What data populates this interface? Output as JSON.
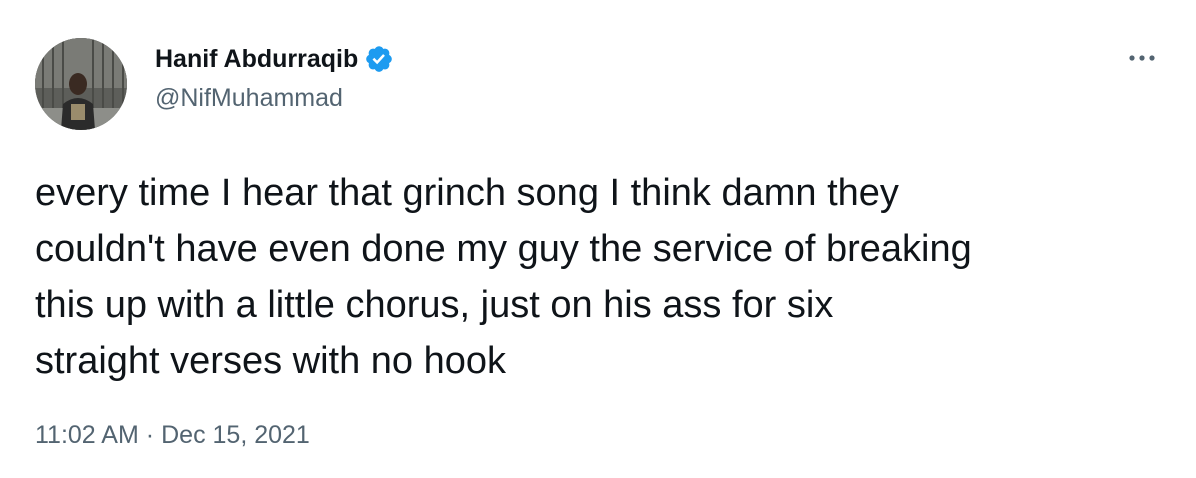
{
  "author": {
    "display_name": "Hanif Abdurraqib",
    "handle": "@NifMuhammad",
    "verified": true,
    "avatar_icon": "avatar-photo"
  },
  "tweet": {
    "lines": [
      "every time I hear that grinch song I think damn they",
      "couldn't have even done my guy the service of breaking",
      "this up with a little chorus, just on his ass for six",
      "straight verses with no hook"
    ],
    "time": "11:02 AM",
    "separator": "·",
    "date": "Dec 15, 2021"
  },
  "icons": {
    "verified": "verified-badge-icon",
    "more": "more-options-icon"
  },
  "colors": {
    "text": "#0f1419",
    "secondary": "#536471",
    "verified": "#1d9bf0"
  }
}
